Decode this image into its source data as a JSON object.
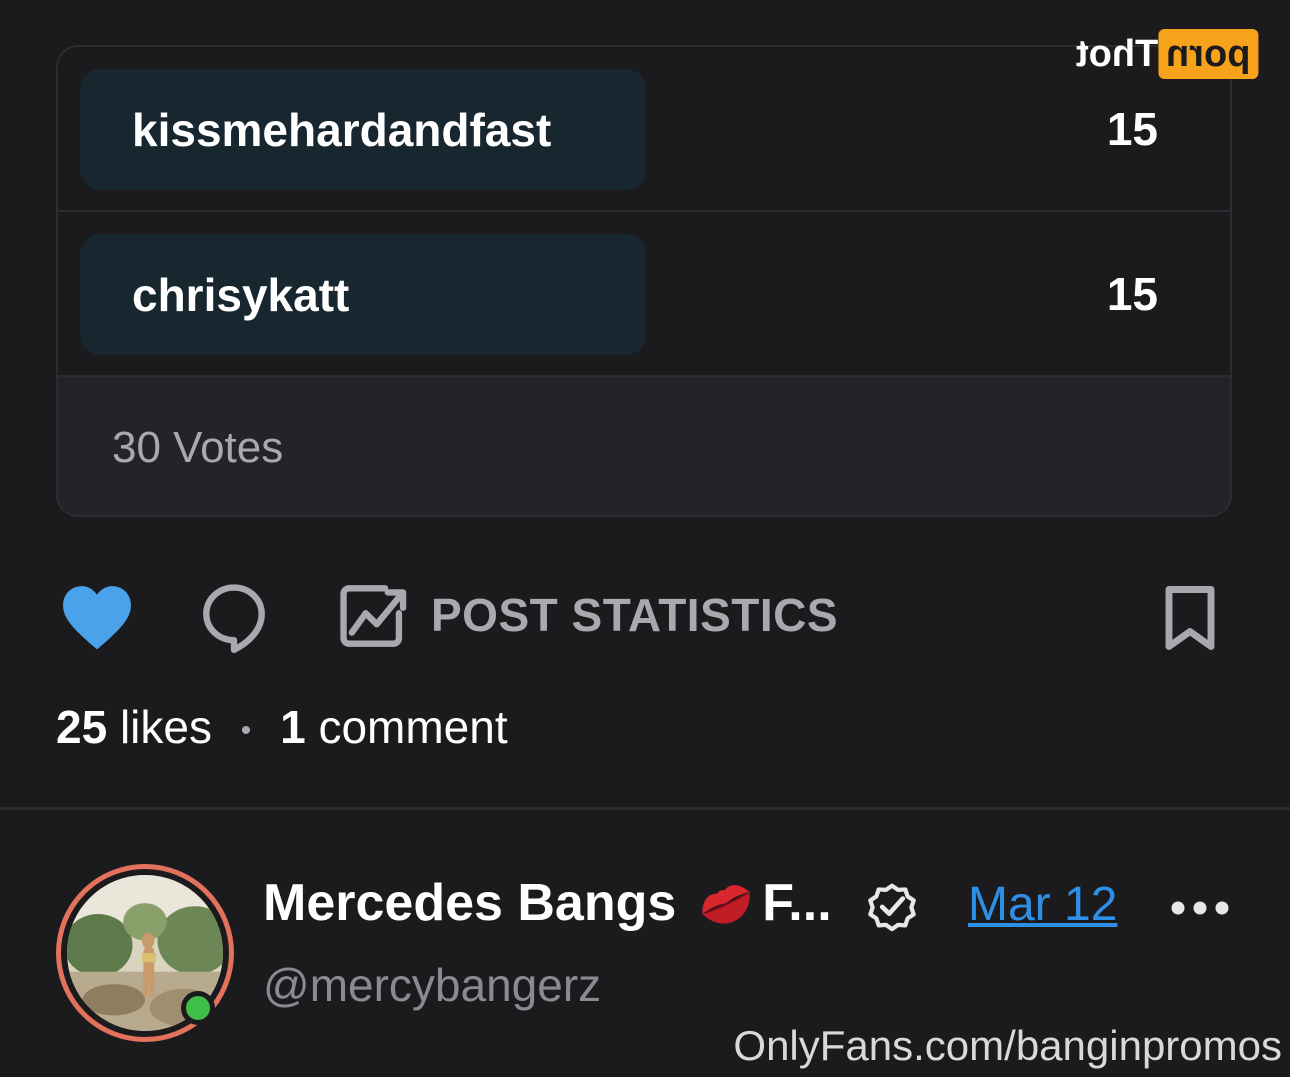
{
  "logo": {
    "highlight": "porn",
    "text": "Thot"
  },
  "poll": {
    "options": [
      {
        "label": "kissmehardandfast",
        "count": "15"
      },
      {
        "label": "chrisykatt",
        "count": "15"
      }
    ],
    "votes": "30 Votes"
  },
  "actions": {
    "like_icon": "heart-icon",
    "comment_icon": "comment-icon",
    "stats_icon": "stats-icon",
    "stats_label": "POST STATISTICS",
    "bookmark_icon": "bookmark-icon"
  },
  "meta": {
    "likes_count": "25",
    "likes_word": "likes",
    "separator": "•",
    "comments_count": "1",
    "comments_word": "comment"
  },
  "author": {
    "name": "Mercedes Bangs",
    "name_suffix": "F...",
    "handle": "@mercybangerz",
    "date": "Mar 12",
    "online": true
  },
  "watermark": {
    "url": "OnlyFans.com/banginpromos"
  },
  "colors": {
    "background": "#1b1b1d",
    "accent_blue": "#2e8fe6",
    "heart": "#4aa3ea",
    "poll_option_bg": "#17262f",
    "online": "#3fbf4a",
    "avatar_ring": "#e2725b",
    "logo_orange": "#f7a21b"
  }
}
